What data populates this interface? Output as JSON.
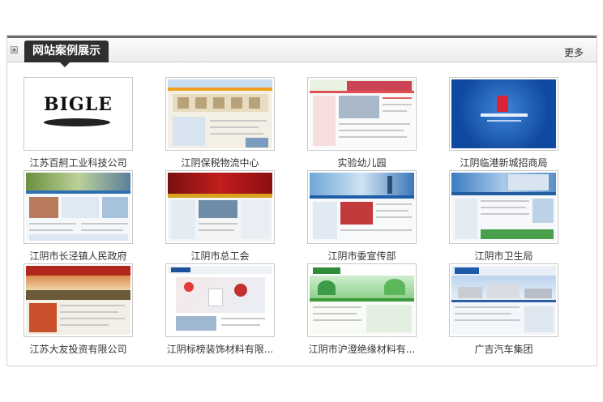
{
  "header": {
    "title": "网站案例展示",
    "more_label": "更多"
  },
  "cases": [
    {
      "name": "江苏百舸工业科技公司",
      "logo_text": "BIGLE"
    },
    {
      "name": "江阴保税物流中心"
    },
    {
      "name": "实验幼儿园"
    },
    {
      "name": "江阴临港新城招商局"
    },
    {
      "name": "江阴市长泾镇人民政府"
    },
    {
      "name": "江阴市总工会"
    },
    {
      "name": "江阴市委宣传部"
    },
    {
      "name": "江阴市卫生局"
    },
    {
      "name": "江苏大友投资有限公司"
    },
    {
      "name": "江阴标榜装饰材料有限..."
    },
    {
      "name": "江阴市沪澄绝缘材料有..."
    },
    {
      "name": "广吉汽车集团"
    }
  ],
  "colors": {
    "title_tab_bg": "#2f2f2f",
    "border": "#d4d4d4"
  }
}
